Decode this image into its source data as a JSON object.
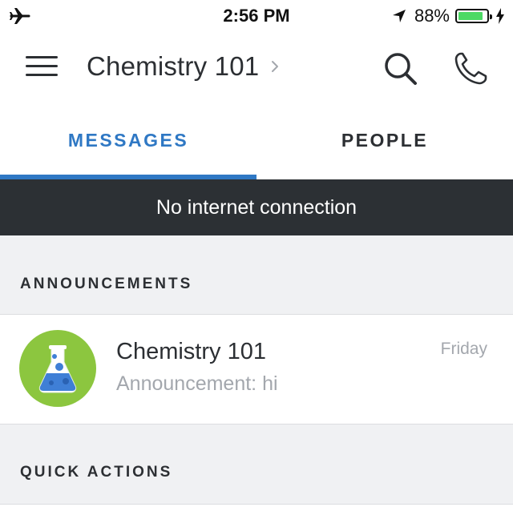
{
  "status_bar": {
    "time": "2:56 PM",
    "battery_percent": "88%",
    "battery_level": 0.88,
    "battery_color": "#4cd964",
    "icons": [
      "airplane-icon",
      "location-arrow-icon",
      "battery-icon",
      "charging-bolt-icon"
    ]
  },
  "header": {
    "title": "Chemistry 101",
    "icons": [
      "hamburger-menu-icon",
      "chevron-right-icon",
      "search-icon",
      "phone-icon"
    ]
  },
  "tabs": [
    {
      "label": "MESSAGES",
      "active": true
    },
    {
      "label": "PEOPLE",
      "active": false
    }
  ],
  "banner": {
    "text": "No internet connection"
  },
  "sections": {
    "announcements": {
      "label": "ANNOUNCEMENTS",
      "items": [
        {
          "course": "Chemistry 101",
          "preview": "Announcement: hi",
          "date": "Friday",
          "icon": "flask-icon"
        }
      ]
    },
    "quick_actions": {
      "label": "QUICK ACTIONS"
    }
  },
  "colors": {
    "accent": "#2f78c4",
    "banner_bg": "#2c3034",
    "section_bg": "#f0f1f3",
    "avatar_bg": "#8cc63f"
  }
}
